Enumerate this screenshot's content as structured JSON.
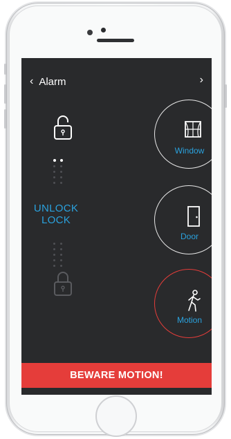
{
  "header": {
    "back_label": "Alarm",
    "back_icon": "chevron-left-icon",
    "next_icon": "chevron-right-icon"
  },
  "lock_panel": {
    "top_icon": "lock-open-icon",
    "bottom_icon": "lock-icon",
    "unlock_label": "UNLOCK",
    "lock_label": "LOCK"
  },
  "sensors": [
    {
      "label": "Window",
      "icon": "window-icon",
      "status": "normal"
    },
    {
      "label": "Door",
      "icon": "door-icon",
      "status": "normal"
    },
    {
      "label": "Motion",
      "icon": "walking-person-icon",
      "status": "alert"
    }
  ],
  "alert_bar": {
    "text": "BEWARE MOTION!"
  },
  "colors": {
    "background": "#292a2c",
    "accent_blue": "#2aa2de",
    "alert_red": "#e53d3a",
    "white": "#ffffff"
  }
}
